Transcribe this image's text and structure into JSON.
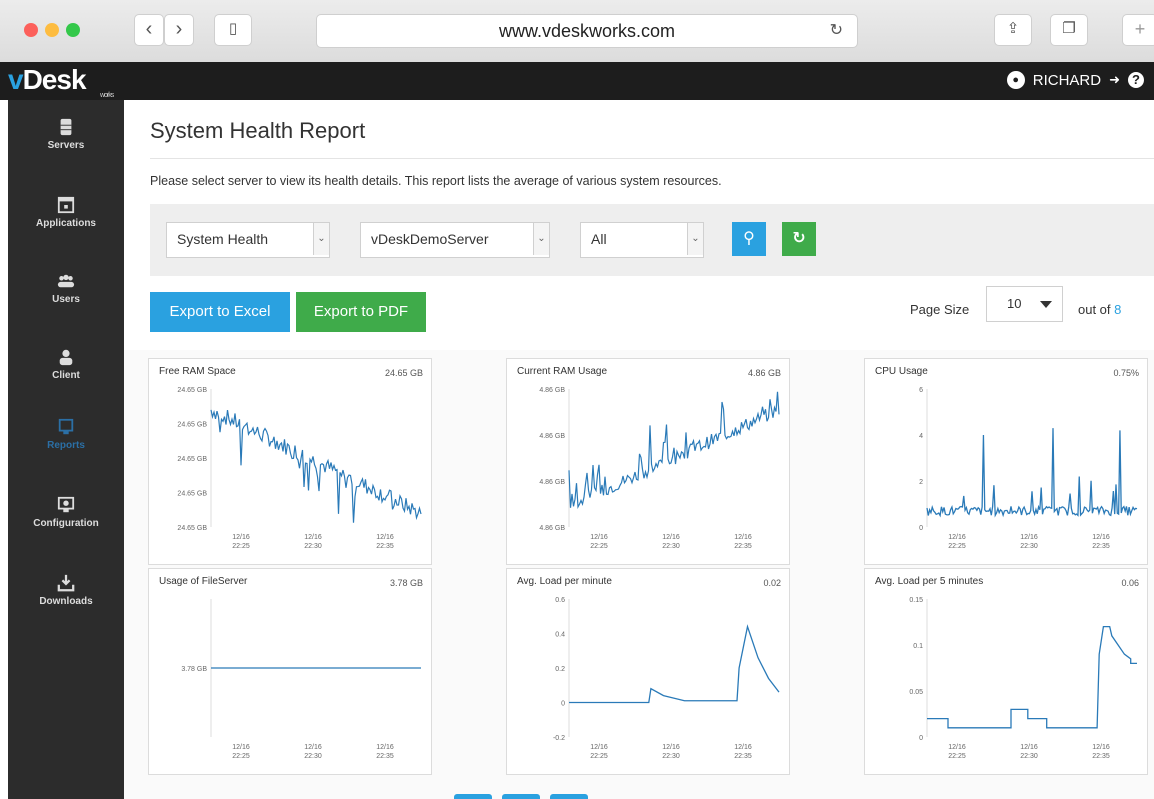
{
  "browser": {
    "url": "www.vdeskworks.com"
  },
  "brand": {
    "v": "v",
    "name": "Desk",
    "sub": "works"
  },
  "user": {
    "name": "RICHARD"
  },
  "sidebar": {
    "items": [
      {
        "label": "Servers",
        "icon": "server-icon"
      },
      {
        "label": "Applications",
        "icon": "applications-icon"
      },
      {
        "label": "Users",
        "icon": "users-icon"
      },
      {
        "label": "Client",
        "icon": "client-icon"
      },
      {
        "label": "Reports",
        "icon": "reports-icon",
        "active": true
      },
      {
        "label": "Configuration",
        "icon": "configuration-icon"
      },
      {
        "label": "Downloads",
        "icon": "downloads-icon"
      }
    ]
  },
  "page": {
    "title": "System Health Report",
    "description": "Please select server to view its health details. This report lists the average of various system resources."
  },
  "filters": {
    "report": "System Health",
    "server": "vDeskDemoServer",
    "period": "All"
  },
  "toolbar": {
    "export_excel": "Export to Excel",
    "export_pdf": "Export to PDF",
    "page_size_label": "Page Size",
    "page_size": "10",
    "out_of_label": "out of",
    "total": "8"
  },
  "colors": {
    "accent": "#2aa1e0",
    "green": "#3fab4a",
    "line": "#2a7ab8"
  },
  "chart_data": [
    {
      "type": "line",
      "title": "Free RAM Space",
      "value": "24.65 GB",
      "yticks": [
        "24.65 GB",
        "24.65 GB",
        "24.65 GB",
        "24.65 GB",
        "24.65 GB"
      ],
      "xticks": [
        "12/16 22:25",
        "12/16 22:30",
        "12/16 22:35"
      ],
      "trend": "decreasing",
      "start": 0.85,
      "end": 0.1,
      "noise": 0.12
    },
    {
      "type": "line",
      "title": "Current RAM Usage",
      "value": "4.86 GB",
      "yticks": [
        "4.86 GB",
        "4.86 GB",
        "4.86 GB",
        "4.86 GB"
      ],
      "xticks": [
        "12/16 22:25",
        "12/16 22:30",
        "12/16 22:35"
      ],
      "trend": "increasing",
      "start": 0.15,
      "end": 0.85,
      "noise": 0.1
    },
    {
      "type": "line",
      "title": "CPU Usage",
      "value": "0.75%",
      "ylim": [
        0,
        6
      ],
      "yticks": [
        "6",
        "4",
        "2",
        "0"
      ],
      "xticks": [
        "12/16 22:25",
        "12/16 22:30",
        "12/16 22:35"
      ],
      "baseline": 0.7,
      "spikes": [
        [
          0.27,
          4.0
        ],
        [
          0.6,
          4.3
        ],
        [
          0.92,
          4.2
        ]
      ]
    },
    {
      "type": "line",
      "title": "Usage of FileServer",
      "value": "3.78 GB",
      "yticks": [
        "3.78 GB"
      ],
      "xticks": [
        "12/16 22:25",
        "12/16 22:30",
        "12/16 22:35"
      ],
      "constant": 3.78
    },
    {
      "type": "line",
      "title": "Avg. Load per minute",
      "value": "0.02",
      "ylim": [
        -0.2,
        0.6
      ],
      "yticks": [
        "0.6",
        "0.4",
        "0.2",
        "0",
        "-0.2"
      ],
      "xticks": [
        "12/16 22:25",
        "12/16 22:30",
        "12/16 22:35"
      ],
      "points": [
        [
          0,
          0
        ],
        [
          0.38,
          0
        ],
        [
          0.39,
          0.08
        ],
        [
          0.45,
          0.04
        ],
        [
          0.55,
          0.01
        ],
        [
          0.8,
          0.01
        ],
        [
          0.81,
          0.2
        ],
        [
          0.85,
          0.44
        ],
        [
          0.9,
          0.26
        ],
        [
          0.95,
          0.14
        ],
        [
          1,
          0.06
        ]
      ]
    },
    {
      "type": "line",
      "title": "Avg. Load per 5 minutes",
      "value": "0.06",
      "ylim": [
        0,
        0.15
      ],
      "yticks": [
        "0.15",
        "0.1",
        "0.05",
        "0"
      ],
      "xticks": [
        "12/16 22:25",
        "12/16 22:30",
        "12/16 22:35"
      ],
      "points": [
        [
          0,
          0.02
        ],
        [
          0.1,
          0.02
        ],
        [
          0.1,
          0.01
        ],
        [
          0.4,
          0.01
        ],
        [
          0.4,
          0.03
        ],
        [
          0.48,
          0.03
        ],
        [
          0.48,
          0.02
        ],
        [
          0.57,
          0.02
        ],
        [
          0.57,
          0.01
        ],
        [
          0.81,
          0.01
        ],
        [
          0.82,
          0.09
        ],
        [
          0.84,
          0.12
        ],
        [
          0.87,
          0.12
        ],
        [
          0.88,
          0.11
        ],
        [
          0.91,
          0.1
        ],
        [
          0.94,
          0.09
        ],
        [
          0.97,
          0.085
        ],
        [
          0.97,
          0.08
        ],
        [
          1,
          0.08
        ]
      ]
    }
  ]
}
